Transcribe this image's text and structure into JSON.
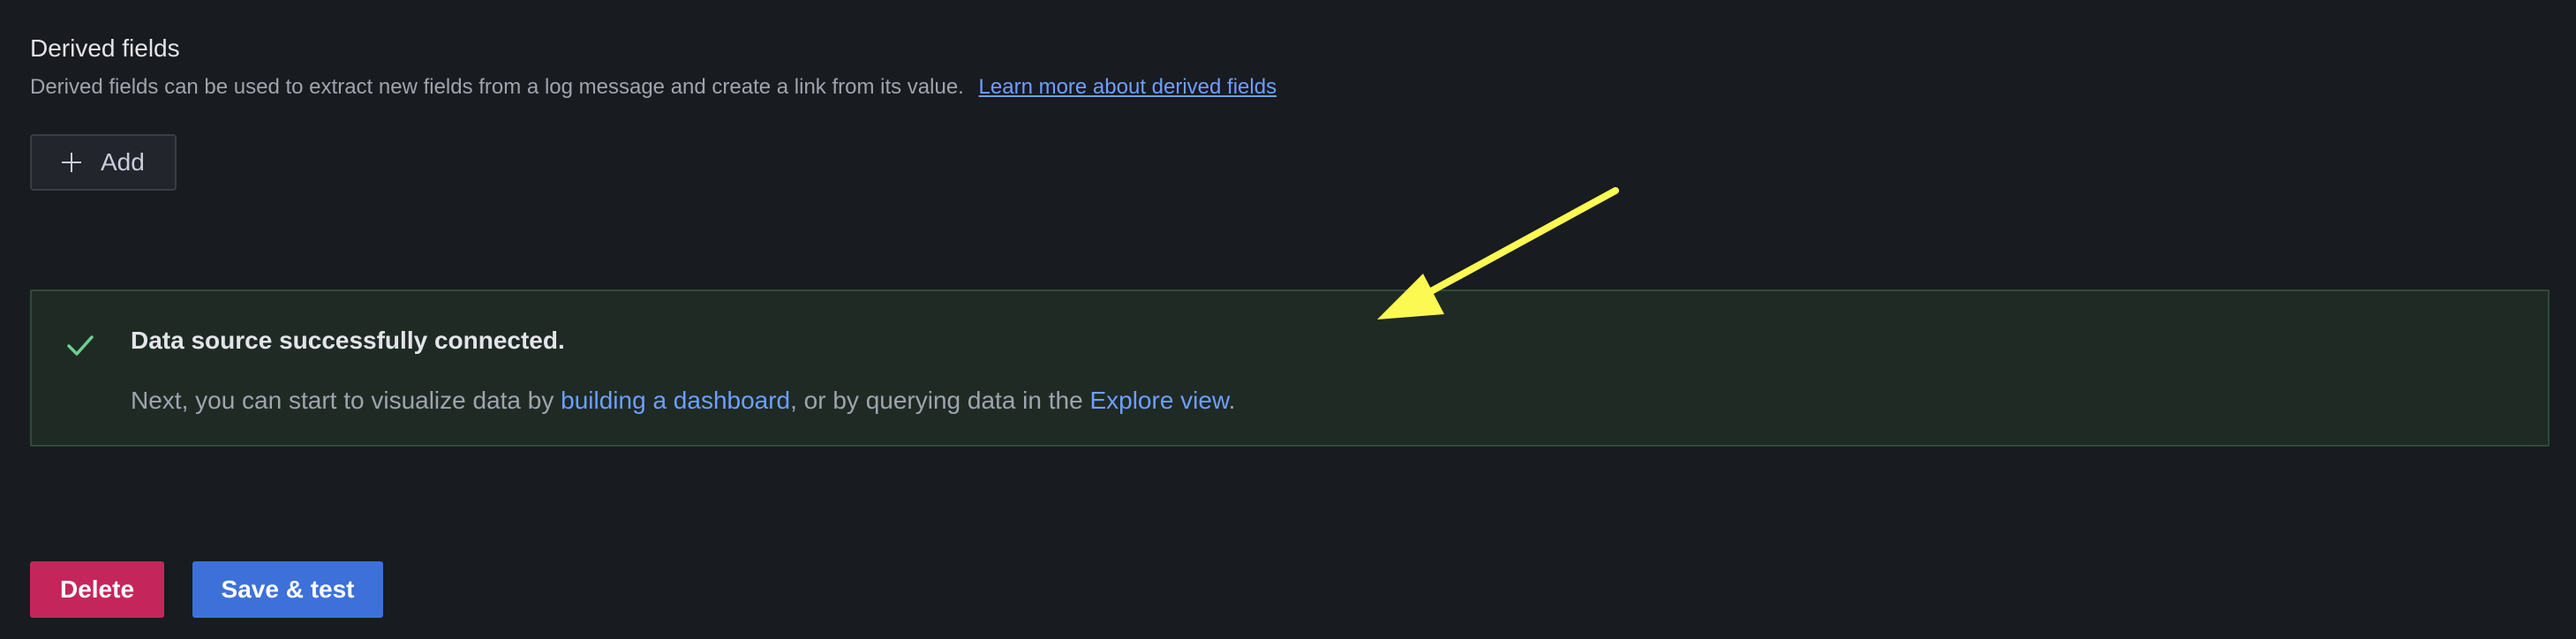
{
  "derived_fields": {
    "title": "Derived fields",
    "description": "Derived fields can be used to extract new fields from a log message and create a link from its value.",
    "learn_more_link": "Learn more about derived fields",
    "add_button_label": "Add",
    "add_icon": "plus-icon"
  },
  "alert": {
    "status_icon": "check-icon",
    "title": "Data source successfully connected.",
    "body_prefix": "Next, you can start to visualize data by ",
    "dashboard_link": "building a dashboard",
    "body_middle": ", or by querying data in the ",
    "explore_link": "Explore view",
    "body_suffix": "."
  },
  "actions": {
    "delete_label": "Delete",
    "save_test_label": "Save & test"
  },
  "colors": {
    "background": "#181b1f",
    "link": "#6e9fff",
    "success_icon": "#6ccf8e",
    "delete": "#c4265b",
    "primary": "#3d71d9",
    "annotation_arrow": "#fcf952"
  }
}
